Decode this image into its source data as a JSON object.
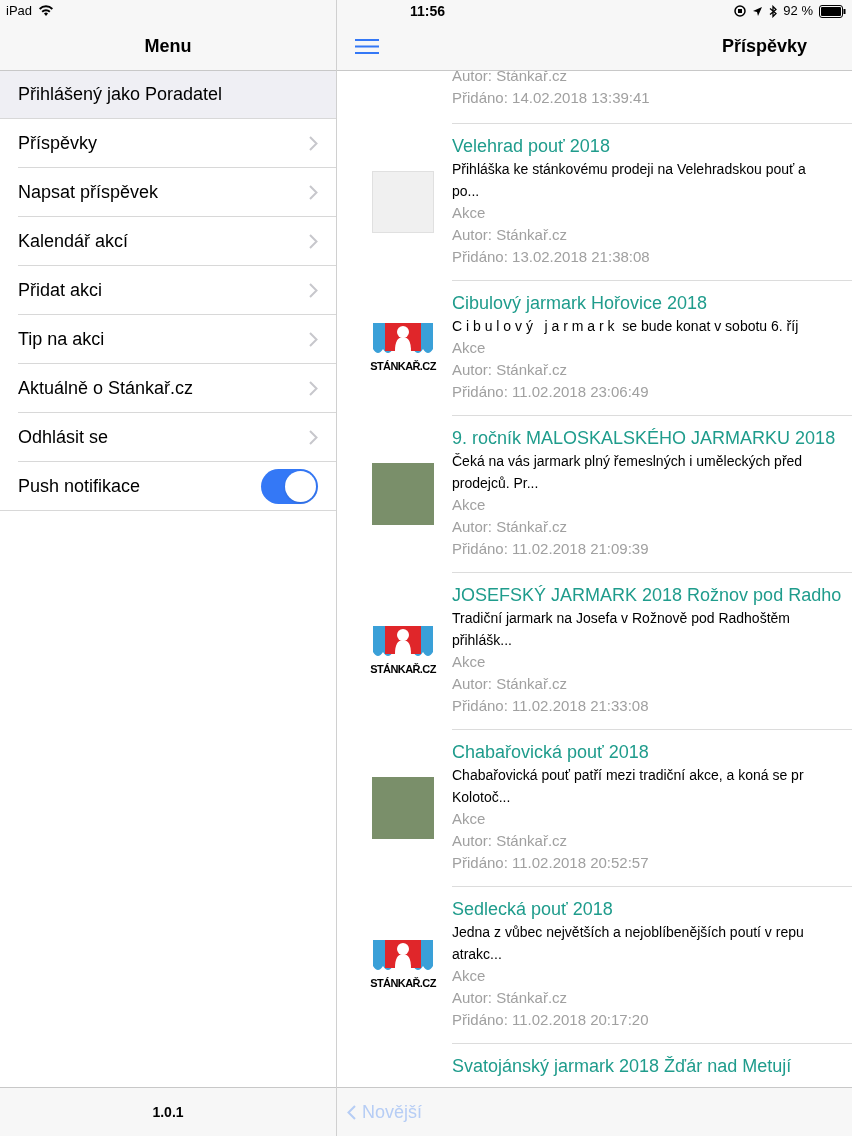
{
  "status_bar": {
    "device": "iPad",
    "time": "11:56",
    "battery": "92 %"
  },
  "menu": {
    "title": "Menu",
    "user_label": "Přihlášený jako Poradatel",
    "items": [
      {
        "kind": "link",
        "label": "Příspěvky"
      },
      {
        "kind": "link",
        "label": "Napsat příspěvek"
      },
      {
        "kind": "link",
        "label": "Kalendář akcí"
      },
      {
        "kind": "link",
        "label": "Přidat akci"
      },
      {
        "kind": "link",
        "label": "Tip na akci"
      },
      {
        "kind": "link",
        "label": "Aktuálně o Stánkař.cz"
      },
      {
        "kind": "link",
        "label": "Odhlásit se"
      },
      {
        "kind": "toggle",
        "label": "Push notifikace",
        "on": true
      }
    ],
    "version": "1.0.1"
  },
  "posts": {
    "title": "Příspěvky",
    "partial_top": {
      "author": "Autor: Stánkař.cz",
      "added": "Přidáno: 14.02.2018 13:39:41"
    },
    "items": [
      {
        "kind": "map",
        "title": "Velehrad pouť 2018",
        "desc_lines": [
          "Přihláška ke stánkovému prodeji na Velehradskou pouť a",
          "po..."
        ],
        "category": "Akce",
        "author": "Autor: Stánkař.cz",
        "added": "Přidáno: 13.02.2018 21:38:08"
      },
      {
        "kind": "logo",
        "logo_text": "STÁNKAŘ.CZ",
        "title": "Cibulový jarmark Hořovice 2018",
        "desc_lines": [
          "C i b u l o v ý   j a r m a r k  se bude konat v sobotu 6. říj"
        ],
        "category": "Akce",
        "author": "Autor: Stánkař.cz",
        "added": "Přidáno: 11.02.2018 23:06:49"
      },
      {
        "kind": "photo",
        "title": "9. ročník MALOSKALSKÉHO JARMARKU 2018",
        "desc_lines": [
          "Čeká na vás jarmark plný řemeslných i uměleckých před",
          "prodejců. Pr..."
        ],
        "category": "Akce",
        "author": "Autor: Stánkař.cz",
        "added": "Přidáno: 11.02.2018 21:09:39"
      },
      {
        "kind": "logo",
        "logo_text": "STÁNKAŘ.CZ",
        "title": "JOSEFSKÝ JARMARK 2018 Rožnov pod Radho",
        "desc_lines": [
          "Tradiční jarmark na Josefa v Rožnově pod Radhoštěm",
          "přihlášk..."
        ],
        "category": "Akce",
        "author": "Autor: Stánkař.cz",
        "added": "Přidáno: 11.02.2018 21:33:08"
      },
      {
        "kind": "photo",
        "title": "Chabařovická pouť 2018",
        "desc_lines": [
          "Chabařovická pouť patří mezi tradiční akce, a koná se pr",
          "Kolotoč..."
        ],
        "category": "Akce",
        "author": "Autor: Stánkař.cz",
        "added": "Přidáno: 11.02.2018 20:52:57"
      },
      {
        "kind": "logo",
        "logo_text": "STÁNKAŘ.CZ",
        "title": "Sedlecká pouť 2018",
        "desc_lines": [
          "Jedna z vůbec největších a nejoblíbenějších poutí v repu",
          "atrakc..."
        ],
        "category": "Akce",
        "author": "Autor: Stánkař.cz",
        "added": "Přidáno: 11.02.2018 20:17:20"
      }
    ],
    "partial_bottom": {
      "title": "Svatojánský jarmark 2018 Žďár nad Metují"
    },
    "newer_button": {
      "label": "Novější",
      "disabled": true
    }
  }
}
